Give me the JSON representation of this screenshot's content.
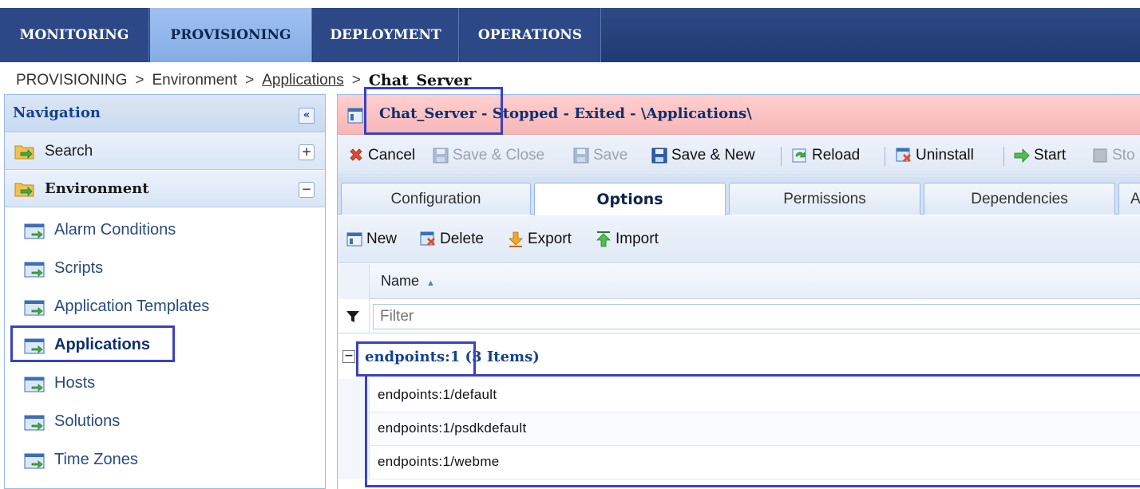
{
  "top_tabs": [
    {
      "label": "MONITORING",
      "active": false
    },
    {
      "label": "PROVISIONING",
      "active": true
    },
    {
      "label": "DEPLOYMENT",
      "active": false
    },
    {
      "label": "OPERATIONS",
      "active": false
    }
  ],
  "breadcrumb": {
    "items": [
      "PROVISIONING",
      "Environment",
      "Applications"
    ],
    "separator": ">",
    "current": "Chat_Server"
  },
  "navigation": {
    "title": "Navigation",
    "collapse_label": "«",
    "sections": [
      {
        "label": "Search",
        "toggle": "+"
      },
      {
        "label": "Environment",
        "toggle": "−"
      }
    ],
    "items": [
      {
        "label": "Alarm Conditions",
        "selected": false
      },
      {
        "label": "Scripts",
        "selected": false
      },
      {
        "label": "Application Templates",
        "selected": false
      },
      {
        "label": "Applications",
        "selected": true
      },
      {
        "label": "Hosts",
        "selected": false
      },
      {
        "label": "Solutions",
        "selected": false
      },
      {
        "label": "Time Zones",
        "selected": false
      }
    ]
  },
  "object": {
    "name": "Chat_Server",
    "status_text": " - Stopped - Exited - \\Applications\\"
  },
  "toolbar": {
    "cancel": "Cancel",
    "save_close": "Save & Close",
    "save": "Save",
    "save_new": "Save & New",
    "reload": "Reload",
    "uninstall": "Uninstall",
    "start": "Start",
    "stop_partial": "Sto"
  },
  "detail_tabs": [
    {
      "label": "Configuration",
      "active": false
    },
    {
      "label": "Options",
      "active": true
    },
    {
      "label": "Permissions",
      "active": false
    },
    {
      "label": "Dependencies",
      "active": false
    },
    {
      "label": "A",
      "active": false
    }
  ],
  "options_toolbar": {
    "new": "New",
    "delete": "Delete",
    "export": "Export",
    "import": "Import"
  },
  "grid": {
    "column_name": "Name",
    "sort_indicator": "▲",
    "filter_placeholder": "Filter",
    "group": {
      "toggle": "−",
      "name": "endpoints:1",
      "count_text": " (3 Items)"
    },
    "rows": [
      "endpoints:1/default",
      "endpoints:1/psdkdefault",
      "endpoints:1/webme"
    ]
  },
  "colors": {
    "topbar": "#1f3a72",
    "active_tab": "#9fc1ef",
    "status_stopped": "#f7b6b6",
    "highlight_box": "#3a41c4",
    "link_blue": "#15428b"
  }
}
